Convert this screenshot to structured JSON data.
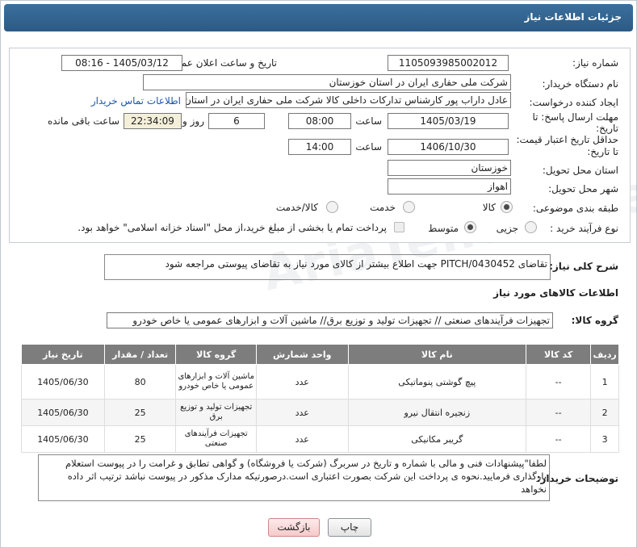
{
  "header": {
    "title": "جزئیات اطلاعات نیاز"
  },
  "form": {
    "need_number_label": "شماره نیاز:",
    "need_number": "1105093985002012",
    "announce_label": "تاریخ و ساعت اعلان عمومی:",
    "announce_value": "1405/03/12 - 08:16",
    "buyer_org_label": "نام دستگاه خریدار:",
    "buyer_org": "شرکت ملی حفاری ایران در استان خوزستان",
    "creator_label": "ایجاد کننده درخواست:",
    "creator": "عادل داراب پور کارشناس تدارکات داخلی کالا شرکت ملی حفاری ایران در استان",
    "contact_link": "اطلاعات تماس خریدار",
    "deadline_label_1": "مهلت ارسال پاسخ: تا",
    "deadline_label_2": "تاریخ:",
    "deadline_date": "1405/03/19",
    "time_label": "ساعت",
    "deadline_time": "08:00",
    "days": "6",
    "days_label": "روز و",
    "remaining_time": "22:34:09",
    "remaining_label": "ساعت باقی مانده",
    "validity_label_1": "حداقل تاریخ اعتبار قیمت:",
    "validity_label_2": "تا تاریخ:",
    "validity_date": "1406/10/30",
    "validity_time": "14:00",
    "province_label": "استان محل تحویل:",
    "province": "خوزستان",
    "city_label": "شهر محل تحویل:",
    "city": "اهواز",
    "category_label": "طبقه بندی موضوعی:",
    "category_options": [
      "کالا",
      "خدمت",
      "کالا/خدمت"
    ],
    "process_label": "نوع فرآیند خرید :",
    "process_options": [
      "جزیی",
      "متوسط"
    ],
    "payment_note": "پرداخت تمام یا بخشی از مبلغ خرید،از محل \"اسناد خزانه اسلامی\" خواهد بود."
  },
  "summary": {
    "label": "شرح کلی نیاز:",
    "text": "تقاضای PITCH/0430452 جهت اطلاع بیشتر از کالای مورد نیاز به تقاضای پیوستی مراجعه شود"
  },
  "goods_section": {
    "title": "اطلاعات کالاهای مورد نیاز",
    "group_label": "گروه کالا:",
    "group_value": "تجهیزات فرآیندهای صنعتی // تجهیزات تولید و توزیع برق//  ماشین آلات و ابزارهای عمومی یا خاص خودرو"
  },
  "table": {
    "headers": [
      "ردیف",
      "کد کالا",
      "نام کالا",
      "واحد شمارش",
      "گروه کالا",
      "تعداد / مقدار",
      "تاریخ نیاز"
    ],
    "rows": [
      [
        "1",
        "--",
        "پیچ گوشتی پنوماتیکی",
        "عدد",
        "ماشین آلات و ابزارهای عمومی یا خاص خودرو",
        "80",
        "1405/06/30"
      ],
      [
        "2",
        "--",
        "زنجیره انتقال نیرو",
        "عدد",
        "تجهیزات تولید و توزیع برق",
        "25",
        "1405/06/30"
      ],
      [
        "3",
        "--",
        "گریبر مکانیکی",
        "عدد",
        "تجهیزات فرآیندهای صنعتی",
        "25",
        "1405/06/30"
      ]
    ]
  },
  "buyer_notes": {
    "label": "توضیحات خریدار:",
    "text": "لطفا\"پیشنهادات فنی و مالی با شماره و تاریخ در سربرگ (شرکت یا فروشگاه) و گواهی تطابق و غرامت را در پیوست استعلام بارگذاری فرمایید.نحوه ی پرداخت این شرکت بصورت اعتباری است.درصورتیکه مدارک مذکور در پیوست نباشد ترتیب اثر داده نخواهد"
  },
  "buttons": {
    "print": "چاپ",
    "back": "بازگشت"
  },
  "watermark": "AriaTender.net"
}
